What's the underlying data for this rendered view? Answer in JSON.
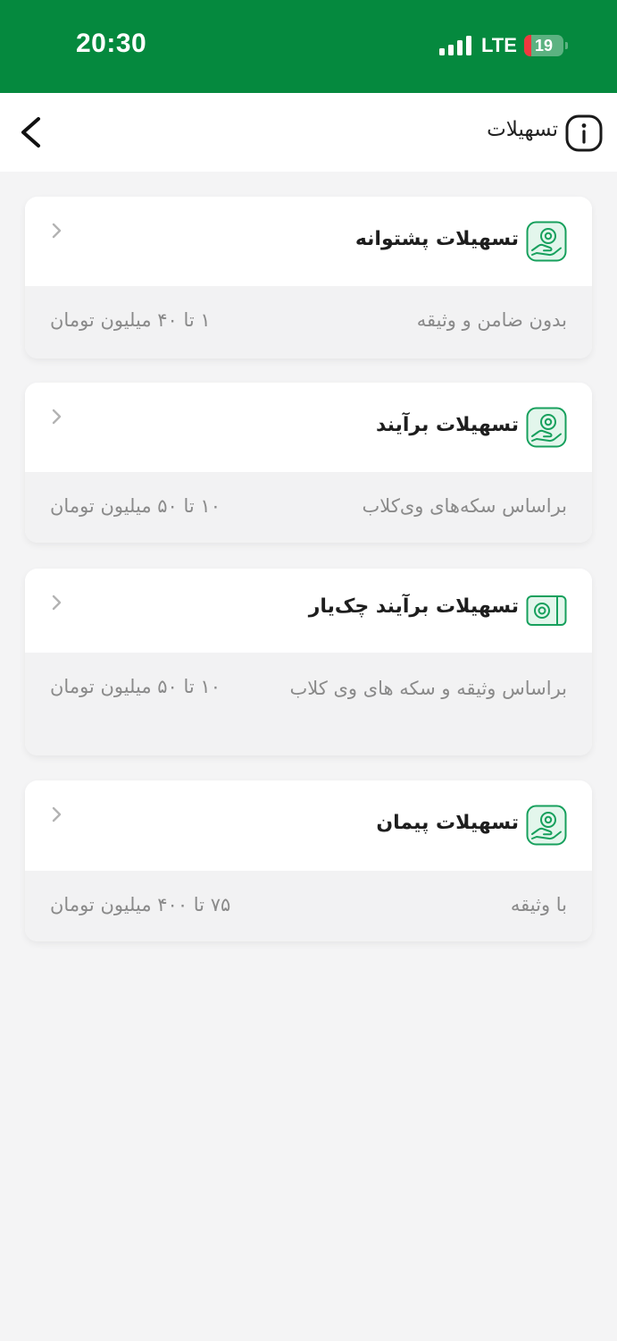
{
  "status_bar": {
    "time": "20:30",
    "network": "LTE",
    "battery": "19",
    "battery_level": 0.19,
    "background_color": "#05893e"
  },
  "header": {
    "title": "تسهیلات",
    "back_icon": "chevron-left-icon",
    "info_icon": "info-circle-icon"
  },
  "loans": [
    {
      "title": "تسهیلات پشتوانه",
      "description": "بدون ضامن و وثیقه",
      "amount": "۱ تا ۴۰ میلیون تومان",
      "icon": "hand-coin-icon"
    },
    {
      "title": "تسهیلات برآیند",
      "description": "براساس سکه‌های وی‌کلاب",
      "amount": "۱۰ تا ۵۰ میلیون تومان",
      "icon": "hand-coin-icon"
    },
    {
      "title": "تسهیلات برآیند چک‌یار",
      "description": "براساس وثیقه و سکه های وی کلاب",
      "amount": "۱۰ تا ۵۰ میلیون تومان",
      "icon": "cheque-icon"
    },
    {
      "title": "تسهیلات پیمان",
      "description": "با وثیقه",
      "amount": "۷۵ تا ۴۰۰ میلیون تومان",
      "icon": "hand-coin-icon"
    }
  ],
  "colors": {
    "accent_green": "#17a05d",
    "icon_fill": "#e3f6ec",
    "page_background": "#f4f4f5"
  }
}
